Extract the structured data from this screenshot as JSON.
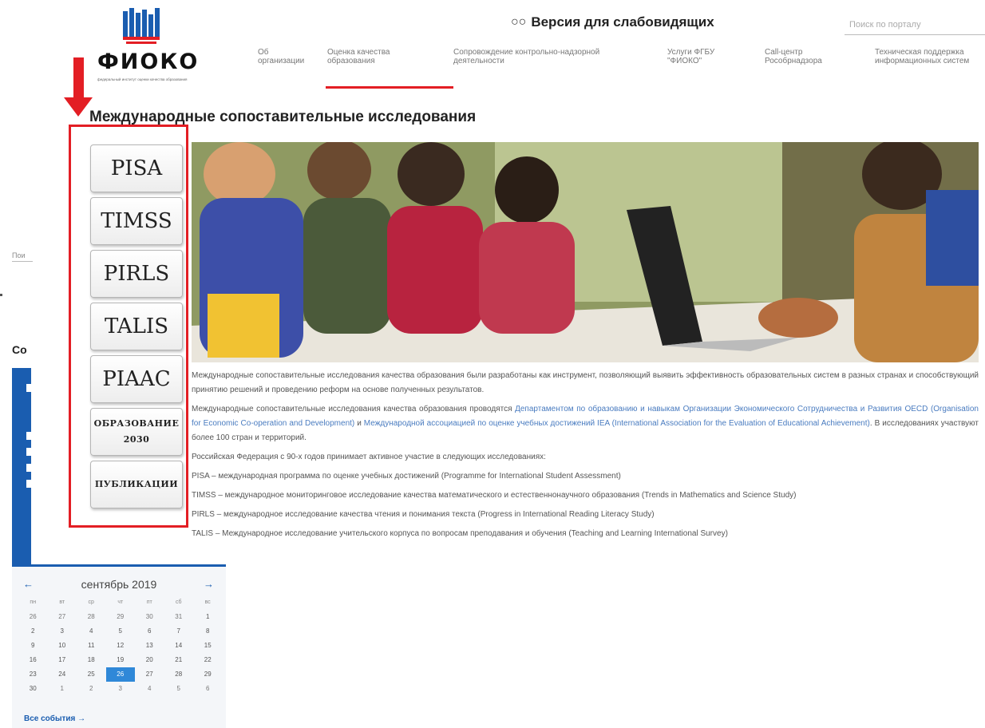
{
  "brand": {
    "name": "ФИОКО",
    "subtitle": "федеральный институт оценки качества образования"
  },
  "header": {
    "vision_label": "Версия для слабовидящих",
    "search_placeholder": "Поиск по порталу"
  },
  "nav": [
    {
      "label": "Об организации"
    },
    {
      "label": "Оценка качества образования"
    },
    {
      "label": "Сопровождение контрольно-надзорной деятельности"
    },
    {
      "label": "Услуги ФГБУ \"ФИОКО\""
    },
    {
      "label": "Call-центр Рособрнадзора"
    },
    {
      "label": "Техническая поддержка информационных систем"
    }
  ],
  "page": {
    "title": "Международные сопоставительные исследования"
  },
  "studies": [
    {
      "label": "PISA"
    },
    {
      "label": "TIMSS"
    },
    {
      "label": "PIRLS"
    },
    {
      "label": "TALIS"
    },
    {
      "label": "PIAAC"
    },
    {
      "label": "ОБРАЗОВАНИЕ 2030"
    },
    {
      "label": "ПУБЛИКАЦИИ"
    }
  ],
  "article": {
    "p1": "Международные сопоставительные исследования качества образования были разработаны как инструмент, позволяющий выявить эффективность образовательных систем в разных странах и способствующий принятию решений и проведению реформ на основе полученных результатов.",
    "p2_start": "Международные сопоставительные исследования качества образования проводятся ",
    "p2_link1": "Департаментом по образованию и навыкам Организации Экономического Сотрудничества и Развития OECD (Organisation for Economic Co-operation and Development)",
    "p2_mid": " и ",
    "p2_link2": "Международной ассоциацией по оценке учебных достижений IEA (International Association for the Evaluation of Educational Achievement)",
    "p2_end": ". В исследованиях участвуют более 100 стран и территорий.",
    "p3": "Российская Федерация с 90-х годов принимает активное участие в следующих исследованиях:",
    "p4": "PISA – международная программа по оценке учебных достижений (Programme for International Student Assessment)",
    "p5": "TIMSS – международное мониторинговое исследование качества математического и естественнонаучного образования (Trends in Mathematics and Science Study)",
    "p6": "PIRLS – международное исследование качества чтения и понимания текста (Progress in International Reading Literacy Study)",
    "p7": "TALIS – Международное исследование учительского корпуса по вопросам преподавания и обучения (Teaching and Learning International Survey)"
  },
  "left_fragments": {
    "search_fragment": "Пои",
    "section_fragment": "Со"
  },
  "calendar": {
    "title": "сентябрь 2019",
    "prev_label": "←",
    "next_label": "→",
    "weekdays": [
      "пн",
      "вт",
      "ср",
      "чт",
      "пт",
      "сб",
      "вс"
    ],
    "weeks": [
      [
        "26",
        "27",
        "28",
        "29",
        "30",
        "31",
        "1"
      ],
      [
        "2",
        "3",
        "4",
        "5",
        "6",
        "7",
        "8"
      ],
      [
        "9",
        "10",
        "11",
        "12",
        "13",
        "14",
        "15"
      ],
      [
        "16",
        "17",
        "18",
        "19",
        "20",
        "21",
        "22"
      ],
      [
        "23",
        "24",
        "25",
        "26",
        "27",
        "28",
        "29"
      ],
      [
        "30",
        "1",
        "2",
        "3",
        "4",
        "5",
        "6"
      ]
    ],
    "today": "26",
    "all_events_label": "Все события",
    "all_events_arrow": "→"
  },
  "colors": {
    "accent_red": "#e31e24",
    "brand_blue": "#1a5db0",
    "calendar_today": "#2f88d8",
    "link": "#4a7cc0"
  }
}
